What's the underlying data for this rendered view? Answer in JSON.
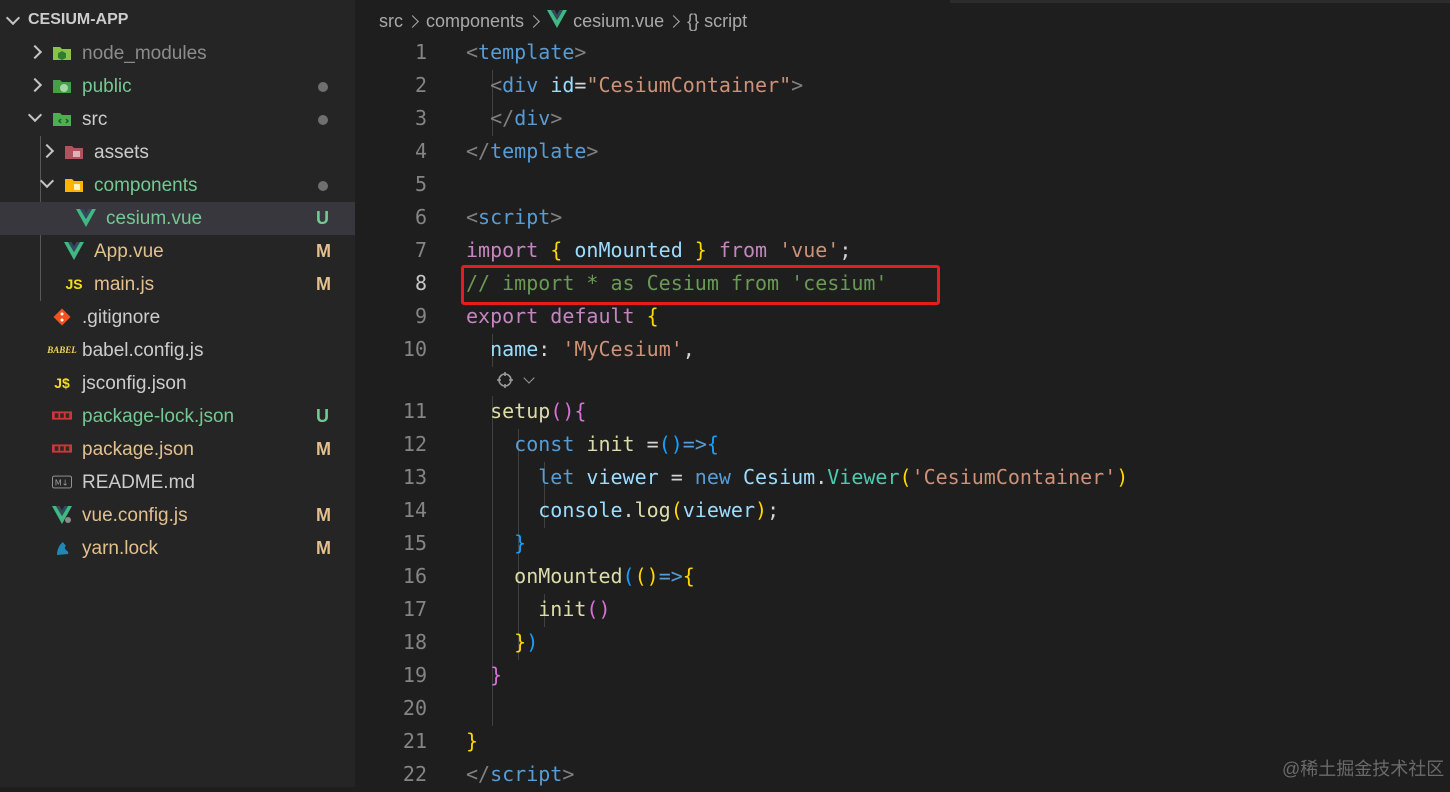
{
  "explorer": {
    "title": "CESIUM-APP",
    "items": [
      {
        "label": "node_modules",
        "status": "",
        "icon": "node-folder-icon",
        "color": "#8c8c8c"
      },
      {
        "label": "public",
        "status": "dot",
        "icon": "public-folder-icon",
        "color": "#73c991"
      },
      {
        "label": "src",
        "status": "dot",
        "icon": "src-folder-icon",
        "color": "#cccccc"
      },
      {
        "label": "assets",
        "status": "",
        "icon": "assets-folder-icon",
        "color": "#cccccc"
      },
      {
        "label": "components",
        "status": "dot",
        "icon": "components-folder-icon",
        "color": "#73c991"
      },
      {
        "label": "cesium.vue",
        "status": "U",
        "icon": "vue-icon",
        "color": "#73c991"
      },
      {
        "label": "App.vue",
        "status": "M",
        "icon": "vue-icon",
        "color": "#e2c08d"
      },
      {
        "label": "main.js",
        "status": "M",
        "icon": "js-icon",
        "color": "#e2c08d"
      },
      {
        "label": ".gitignore",
        "status": "",
        "icon": "git-icon",
        "color": "#cccccc"
      },
      {
        "label": "babel.config.js",
        "status": "",
        "icon": "babel-icon",
        "color": "#cccccc"
      },
      {
        "label": "jsconfig.json",
        "status": "",
        "icon": "json-icon",
        "color": "#cccccc"
      },
      {
        "label": "package-lock.json",
        "status": "U",
        "icon": "npm-icon",
        "color": "#73c991"
      },
      {
        "label": "package.json",
        "status": "M",
        "icon": "npm-icon",
        "color": "#e2c08d"
      },
      {
        "label": "README.md",
        "status": "",
        "icon": "markdown-icon",
        "color": "#cccccc"
      },
      {
        "label": "vue.config.js",
        "status": "M",
        "icon": "vue-config-icon",
        "color": "#e2c08d"
      },
      {
        "label": "yarn.lock",
        "status": "M",
        "icon": "yarn-icon",
        "color": "#e2c08d"
      }
    ]
  },
  "breadcrumb": {
    "parts": [
      "src",
      "components",
      "cesium.vue",
      "{} script"
    ]
  },
  "editor": {
    "active_line": 8,
    "lines": [
      {
        "n": "1",
        "tokens": [
          [
            "<",
            "#808080"
          ],
          [
            "template",
            "#569cd6"
          ],
          [
            ">",
            "#808080"
          ]
        ]
      },
      {
        "n": "2",
        "tokens": [
          [
            "  ",
            ""
          ],
          [
            "<",
            "#808080"
          ],
          [
            "div",
            "#569cd6"
          ],
          [
            " ",
            ""
          ],
          [
            "id",
            "#9cdcfe"
          ],
          [
            "=",
            "#d4d4d4"
          ],
          [
            "\"CesiumContainer\"",
            "#ce9178"
          ],
          [
            ">",
            "#808080"
          ]
        ]
      },
      {
        "n": "3",
        "tokens": [
          [
            "  ",
            ""
          ],
          [
            "</",
            "#808080"
          ],
          [
            "div",
            "#569cd6"
          ],
          [
            ">",
            "#808080"
          ]
        ]
      },
      {
        "n": "4",
        "tokens": [
          [
            "</",
            "#808080"
          ],
          [
            "template",
            "#569cd6"
          ],
          [
            ">",
            "#808080"
          ]
        ]
      },
      {
        "n": "5",
        "tokens": []
      },
      {
        "n": "6",
        "tokens": [
          [
            "<",
            "#808080"
          ],
          [
            "script",
            "#569cd6"
          ],
          [
            ">",
            "#808080"
          ]
        ]
      },
      {
        "n": "7",
        "tokens": [
          [
            "import",
            "#c586c0"
          ],
          [
            " ",
            ""
          ],
          [
            "{",
            "#ffd700"
          ],
          [
            " onMounted ",
            "#9cdcfe"
          ],
          [
            "}",
            "#ffd700"
          ],
          [
            " ",
            ""
          ],
          [
            "from",
            "#c586c0"
          ],
          [
            " ",
            ""
          ],
          [
            "'vue'",
            "#ce9178"
          ],
          [
            ";",
            "#d4d4d4"
          ]
        ]
      },
      {
        "n": "8",
        "tokens": [
          [
            "// import * as Cesium from 'cesium'",
            "#6a9955"
          ]
        ]
      },
      {
        "n": "9",
        "tokens": [
          [
            "export",
            "#c586c0"
          ],
          [
            " ",
            ""
          ],
          [
            "default",
            "#c586c0"
          ],
          [
            " ",
            ""
          ],
          [
            "{",
            "#ffd700"
          ]
        ]
      },
      {
        "n": "10",
        "tokens": [
          [
            "  ",
            ""
          ],
          [
            "name",
            "#9cdcfe"
          ],
          [
            ": ",
            "#d4d4d4"
          ],
          [
            "'MyCesium'",
            "#ce9178"
          ],
          [
            ",",
            "#d4d4d4"
          ]
        ]
      },
      {
        "n": "11",
        "tokens": [
          [
            "  ",
            ""
          ],
          [
            "setup",
            "#dcdcaa"
          ],
          [
            "()",
            "#da70d6"
          ],
          [
            "{",
            "#da70d6"
          ]
        ]
      },
      {
        "n": "12",
        "tokens": [
          [
            "    ",
            ""
          ],
          [
            "const",
            "#569cd6"
          ],
          [
            " ",
            ""
          ],
          [
            "init",
            "#dcdcaa"
          ],
          [
            " =",
            "#d4d4d4"
          ],
          [
            "()",
            "#179fff"
          ],
          [
            "=>",
            "#569cd6"
          ],
          [
            "{",
            "#179fff"
          ]
        ]
      },
      {
        "n": "13",
        "tokens": [
          [
            "      ",
            ""
          ],
          [
            "let",
            "#569cd6"
          ],
          [
            " ",
            ""
          ],
          [
            "viewer",
            "#9cdcfe"
          ],
          [
            " = ",
            "#d4d4d4"
          ],
          [
            "new",
            "#569cd6"
          ],
          [
            " ",
            ""
          ],
          [
            "Cesium",
            "#9cdcfe"
          ],
          [
            ".",
            "#d4d4d4"
          ],
          [
            "Viewer",
            "#4ec9b0"
          ],
          [
            "(",
            "#ffd700"
          ],
          [
            "'CesiumContainer'",
            "#ce9178"
          ],
          [
            ")",
            "#ffd700"
          ]
        ]
      },
      {
        "n": "14",
        "tokens": [
          [
            "      ",
            ""
          ],
          [
            "console",
            "#9cdcfe"
          ],
          [
            ".",
            "#d4d4d4"
          ],
          [
            "log",
            "#dcdcaa"
          ],
          [
            "(",
            "#ffd700"
          ],
          [
            "viewer",
            "#9cdcfe"
          ],
          [
            ")",
            "#ffd700"
          ],
          [
            ";",
            "#d4d4d4"
          ]
        ]
      },
      {
        "n": "15",
        "tokens": [
          [
            "    ",
            ""
          ],
          [
            "}",
            "#179fff"
          ]
        ]
      },
      {
        "n": "16",
        "tokens": [
          [
            "    ",
            ""
          ],
          [
            "onMounted",
            "#dcdcaa"
          ],
          [
            "(",
            "#179fff"
          ],
          [
            "()",
            "#ffd700"
          ],
          [
            "=>",
            "#569cd6"
          ],
          [
            "{",
            "#ffd700"
          ]
        ]
      },
      {
        "n": "17",
        "tokens": [
          [
            "      ",
            ""
          ],
          [
            "init",
            "#dcdcaa"
          ],
          [
            "()",
            "#da70d6"
          ]
        ]
      },
      {
        "n": "18",
        "tokens": [
          [
            "    ",
            ""
          ],
          [
            "}",
            "#ffd700"
          ],
          [
            ")",
            "#179fff"
          ]
        ]
      },
      {
        "n": "19",
        "tokens": [
          [
            "  ",
            ""
          ],
          [
            "}",
            "#da70d6"
          ]
        ]
      },
      {
        "n": "20",
        "tokens": []
      },
      {
        "n": "21",
        "tokens": [
          [
            "}",
            "#ffd700"
          ]
        ]
      },
      {
        "n": "22",
        "tokens": [
          [
            "</",
            "#808080"
          ],
          [
            "script",
            "#569cd6"
          ],
          [
            ">",
            "#808080"
          ]
        ]
      }
    ]
  },
  "watermark": "@稀土掘金技术社区"
}
